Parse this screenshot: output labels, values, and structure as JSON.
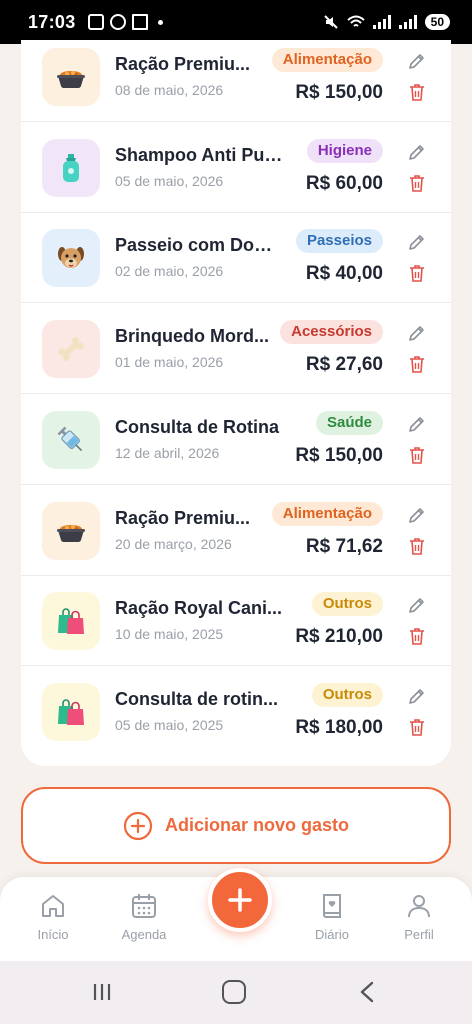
{
  "status_bar": {
    "time": "17:03",
    "battery": "50"
  },
  "expenses": [
    {
      "title": "Ração Premiu...",
      "date": "08 de maio, 2026",
      "category": "Alimentação",
      "amount": "R$ 150,00",
      "icon": "pet-food-bowl-icon",
      "badge_bg": "#fde9d6",
      "badge_fg": "#e0631f",
      "thumb_bg": "#fdf0df"
    },
    {
      "title": "Shampoo Anti Pul...",
      "date": "05 de maio, 2026",
      "category": "Higiene",
      "amount": "R$ 60,00",
      "icon": "shampoo-bottle-icon",
      "badge_bg": "#efe1f7",
      "badge_fg": "#8a2fb8",
      "thumb_bg": "#f1e6f7"
    },
    {
      "title": "Passeio com Dog ...",
      "date": "02 de maio, 2026",
      "category": "Passeios",
      "amount": "R$ 40,00",
      "icon": "dog-face-icon",
      "badge_bg": "#dcecfb",
      "badge_fg": "#2f6fb3",
      "thumb_bg": "#e3f0fb"
    },
    {
      "title": "Brinquedo Mord...",
      "date": "01 de maio, 2026",
      "category": "Acessórios",
      "amount": "R$ 27,60",
      "icon": "bone-icon",
      "badge_bg": "#fbe2de",
      "badge_fg": "#c63a2f",
      "thumb_bg": "#fbe7e3"
    },
    {
      "title": "Consulta de Rotina",
      "date": "12 de abril, 2026",
      "category": "Saúde",
      "amount": "R$ 150,00",
      "icon": "syringe-icon",
      "badge_bg": "#dff2e2",
      "badge_fg": "#2e8b3d",
      "thumb_bg": "#e3f3e6"
    },
    {
      "title": "Ração Premiu...",
      "date": "20 de março, 2026",
      "category": "Alimentação",
      "amount": "R$ 71,62",
      "icon": "pet-food-bowl-icon",
      "badge_bg": "#fde9d6",
      "badge_fg": "#e0631f",
      "thumb_bg": "#fdf0df"
    },
    {
      "title": "Ração Royal Cani...",
      "date": "10 de maio, 2025",
      "category": "Outros",
      "amount": "R$ 210,00",
      "icon": "shopping-bags-icon",
      "badge_bg": "#fdf3d2",
      "badge_fg": "#c98a09",
      "thumb_bg": "#fdf8dc"
    },
    {
      "title": "Consulta de rotin...",
      "date": "05 de maio, 2025",
      "category": "Outros",
      "amount": "R$ 180,00",
      "icon": "shopping-bags-icon",
      "badge_bg": "#fdf3d2",
      "badge_fg": "#c98a09",
      "thumb_bg": "#fdf8dc"
    }
  ],
  "add_button": {
    "label": "Adicionar novo gasto"
  },
  "nav": {
    "home": "Início",
    "agenda": "Agenda",
    "diary": "Diário",
    "profile": "Perfil"
  },
  "colors": {
    "accent": "#ee6a3d",
    "delete": "#e4534a"
  }
}
